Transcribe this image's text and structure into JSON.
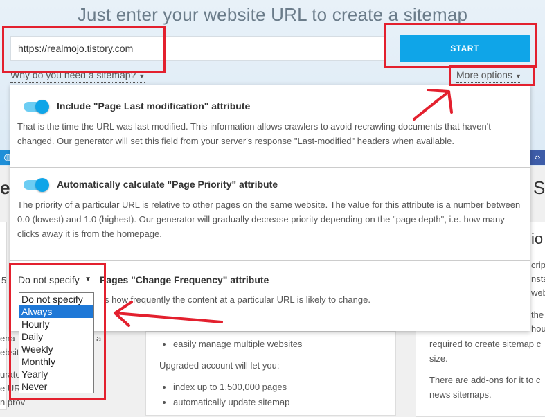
{
  "hero": {
    "headline": "Just enter your website URL to create a sitemap",
    "url_value": "https://realmojo.tistory.com",
    "start_label": "START",
    "why_label": "Why do you need a sitemap?",
    "more_label": "More options"
  },
  "options": [
    {
      "title": "Include \"Page Last modification\" attribute",
      "description": "That is the time the URL was last modified. This information allows crawlers to avoid recrawling documents that haven't changed. Our generator will set this field from your server's response \"Last-modified\" headers when available.",
      "enabled": true
    },
    {
      "title": "Automatically calculate \"Page Priority\" attribute",
      "description": "The priority of a particular URL is relative to other pages on the same website. The value for this attribute is a number between 0.0 (lowest) and 1.0 (highest). Our generator will gradually decrease priority depending on the \"page depth\", i.e. how many clicks away it is from the homepage.",
      "enabled": true
    }
  ],
  "frequency": {
    "selected_label": "Do not specify",
    "title_tail": "Pages \"Change Frequency\" attribute",
    "desc_tail": "s how frequently the content at a particular URL is likely to change.",
    "options": [
      "Do not specify",
      "Always",
      "Hourly",
      "Daily",
      "Weekly",
      "Monthly",
      "Yearly",
      "Never"
    ],
    "highlighted": "Always"
  },
  "background": {
    "left_fragments": [
      "e",
      "5",
      "ena",
      "ebsit",
      "urato",
      "e UR",
      "n prov"
    ],
    "left_char_a": "a",
    "center_list": [
      "easily manage multiple websites"
    ],
    "center_text": "Upgraded account will let you:",
    "center_list2": [
      "index up to 1,500,000 pages",
      "automatically update sitemap"
    ],
    "right_heading_fragment": "S",
    "right_heading2_fragment": "io",
    "right_fragments": [
      "cript",
      "nsta",
      "web",
      "the",
      "houg"
    ],
    "right_text1": "required to create sitemap c",
    "right_text1b": "size.",
    "right_text2": "There are add-ons for it to c",
    "right_text2b": "news sitemaps."
  },
  "colors": {
    "accent": "#0fa5e8",
    "annotation_red": "#e3202e",
    "selected_item": "#1e78d7",
    "icon_left": "#1e8fd8",
    "icon_right": "#3d5ca8"
  }
}
